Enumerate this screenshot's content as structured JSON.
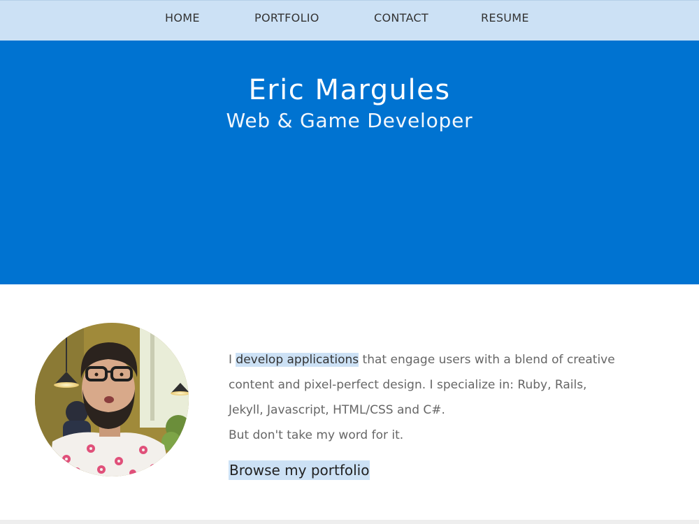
{
  "nav": {
    "home": "HOME",
    "portfolio": "PORTFOLIO",
    "contact": "CONTACT",
    "resume": "RESUME"
  },
  "hero": {
    "name": "Eric Margules",
    "subtitle": "Web & Game Developer"
  },
  "intro": {
    "lead": "I ",
    "highlight": "develop applications",
    "rest": " that engage users with a blend of creative content and pixel-perfect design. I specialize in: Ruby, Rails, Jekyll, Javascript, HTML/CSS and C#.",
    "line2": "But don't take my word for it."
  },
  "cta": {
    "browse_label": "Browse my portfolio"
  },
  "colors": {
    "nav_bg": "#cce1f5",
    "hero_bg": "#0073d1",
    "highlight": "#cce1f5"
  }
}
